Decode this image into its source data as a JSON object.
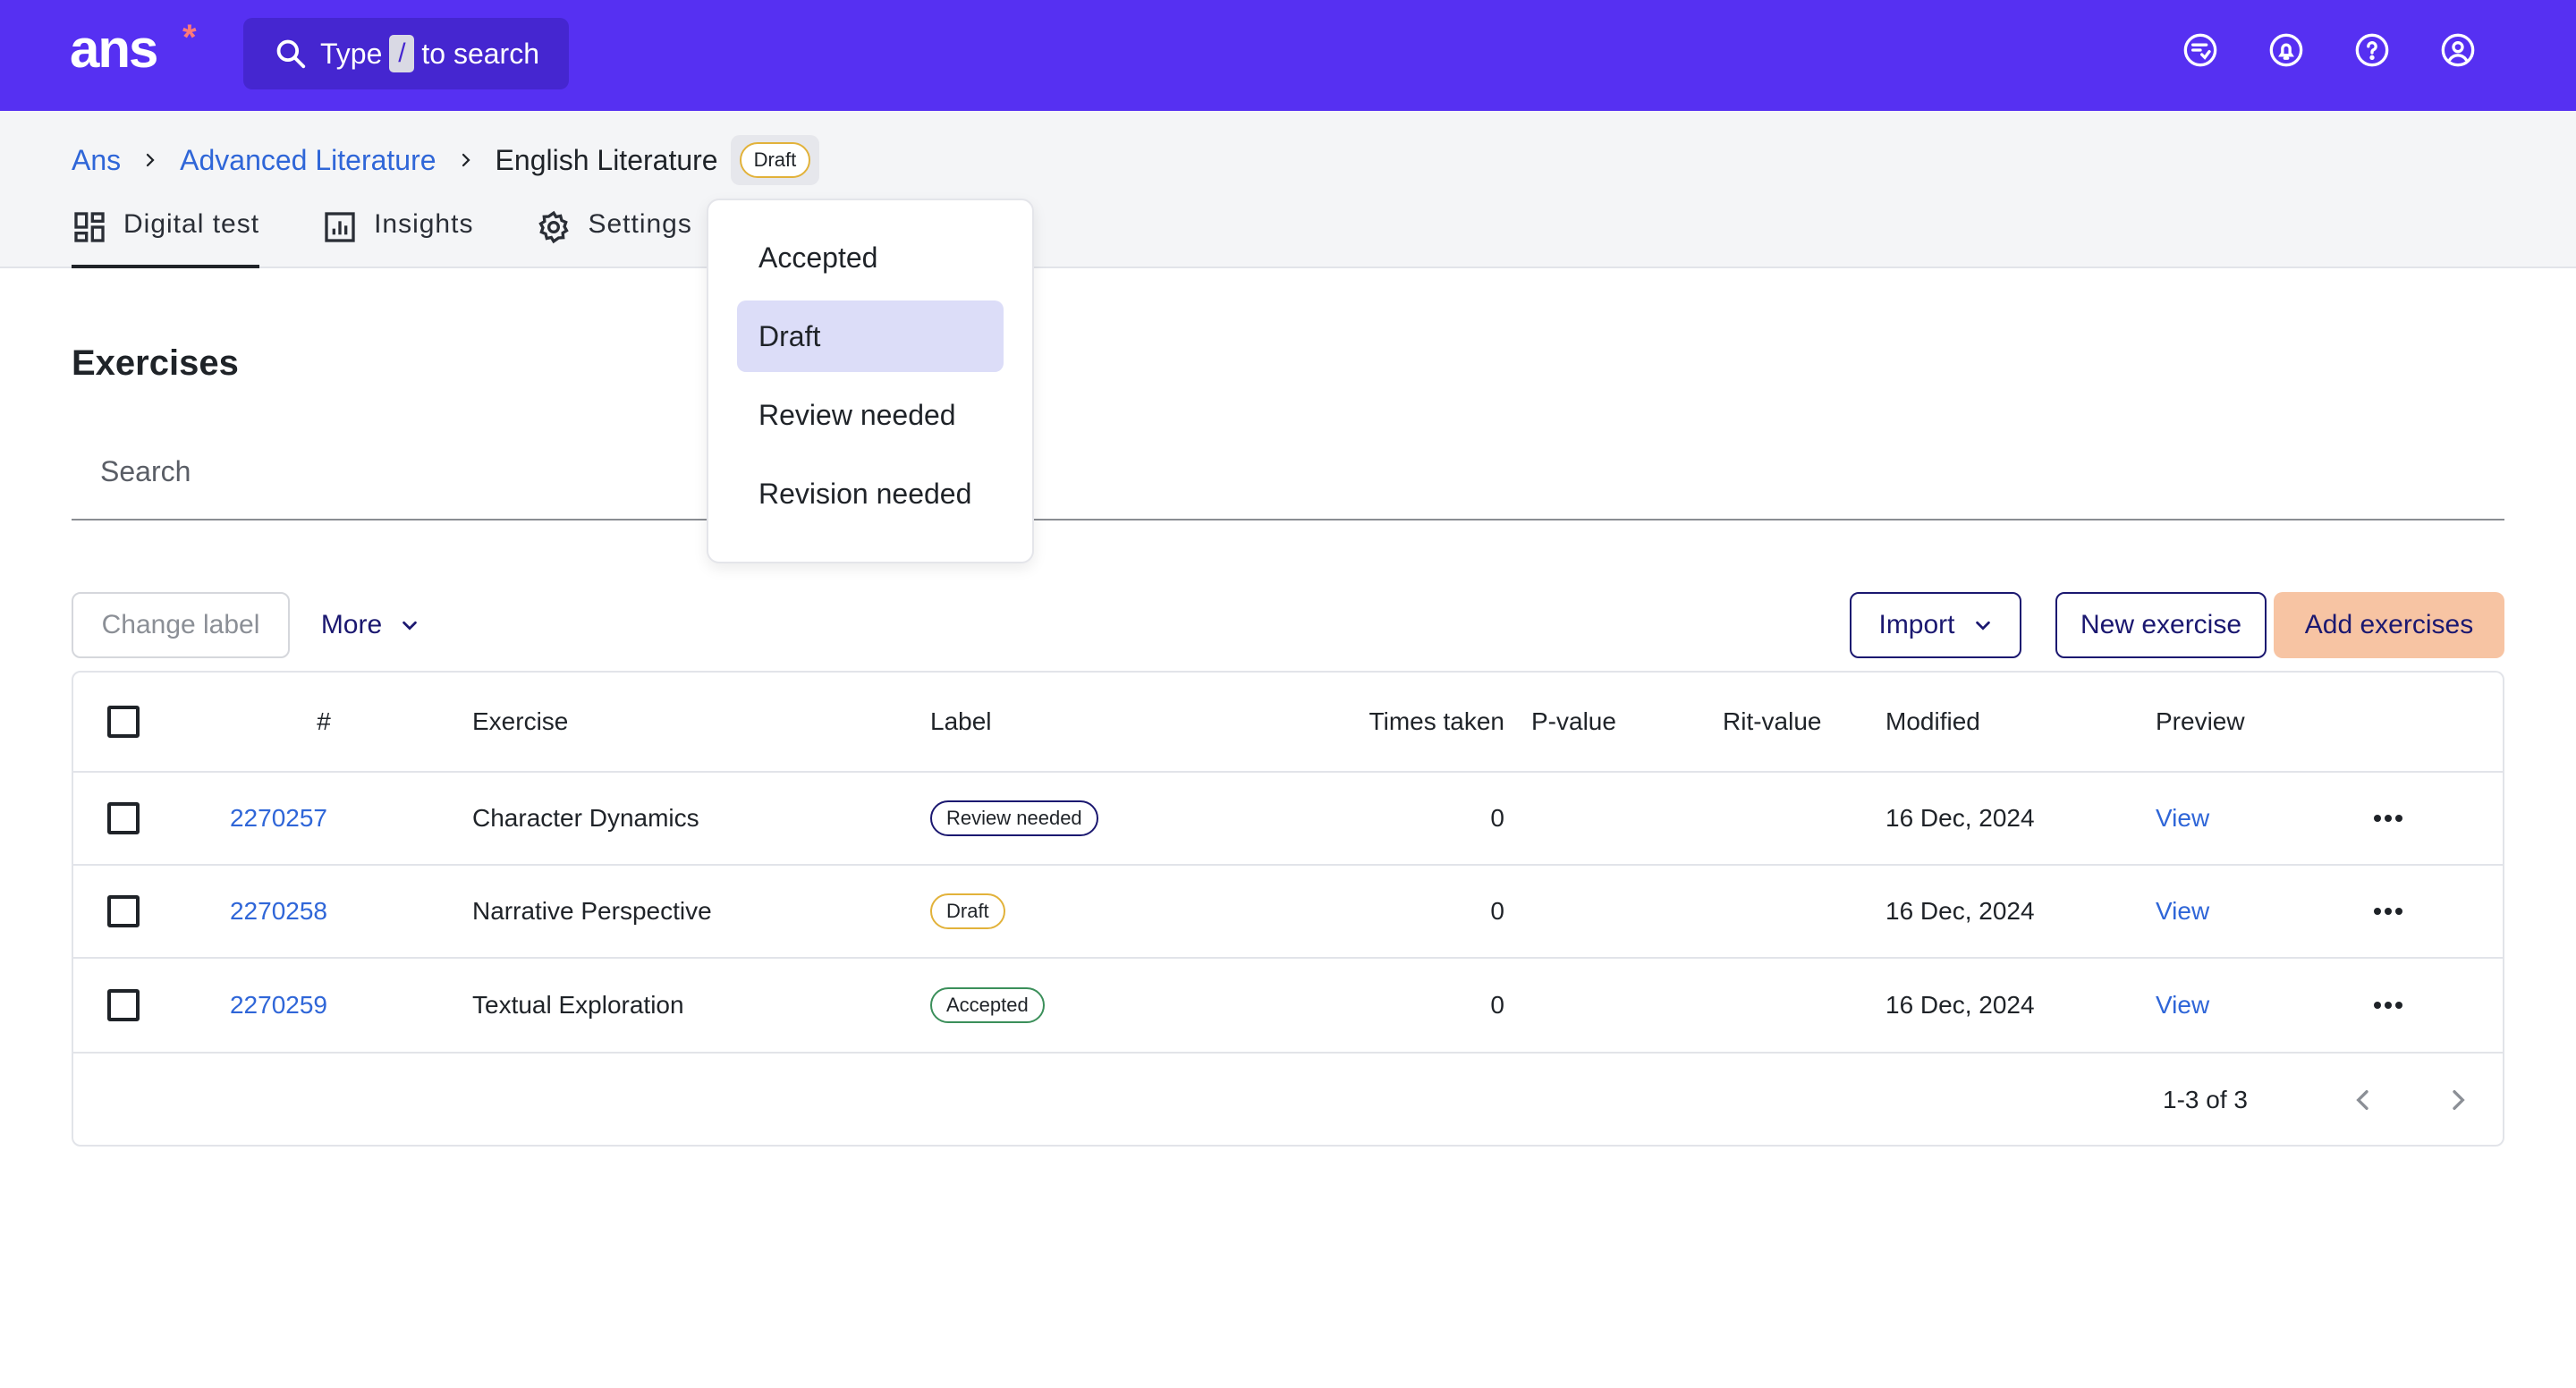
{
  "app": {
    "logo": "ans",
    "logo_mark": "*"
  },
  "search": {
    "prefix": "Type",
    "key": "/",
    "suffix": "to search"
  },
  "top_icons": [
    "checklist-icon",
    "bell-icon",
    "help-icon",
    "account-icon"
  ],
  "breadcrumb": {
    "items": [
      "Ans",
      "Advanced Literature"
    ],
    "current": "English Literature",
    "status": "Draft"
  },
  "tabs": [
    {
      "label": "Digital test",
      "icon": "grid-icon",
      "active": true
    },
    {
      "label": "Insights",
      "icon": "chart-icon"
    },
    {
      "label": "Settings",
      "icon": "gear-icon"
    }
  ],
  "status_menu": {
    "options": [
      "Accepted",
      "Draft",
      "Review needed",
      "Revision needed"
    ],
    "selected": "Draft"
  },
  "exercises": {
    "title": "Exercises",
    "search_placeholder": "Search"
  },
  "toolbar": {
    "change_label": "Change label",
    "more": "More",
    "import": "Import",
    "new_exercise": "New exercise",
    "add_exercises": "Add exercises"
  },
  "table": {
    "columns": [
      "#",
      "Exercise",
      "Label",
      "Times taken",
      "P-value",
      "Rit-value",
      "Modified",
      "Preview"
    ],
    "rows": [
      {
        "id": "2270257",
        "exercise": "Character Dynamics",
        "label": "Review needed",
        "times_taken": "0",
        "p_value": "",
        "rit_value": "",
        "modified": "16 Dec, 2024",
        "preview": "View"
      },
      {
        "id": "2270258",
        "exercise": "Narrative Perspective",
        "label": "Draft",
        "times_taken": "0",
        "p_value": "",
        "rit_value": "",
        "modified": "16 Dec, 2024",
        "preview": "View"
      },
      {
        "id": "2270259",
        "exercise": "Textual Exploration",
        "label": "Accepted",
        "times_taken": "0",
        "p_value": "",
        "rit_value": "",
        "modified": "16 Dec, 2024",
        "preview": "View"
      }
    ],
    "pagination": "1-3 of 3"
  },
  "colors": {
    "topbar": "#5630f2",
    "link": "#2f66d8",
    "primary_text": "#1b1870",
    "add_button": "#f7c4a3",
    "draft": "#e2b23a",
    "accepted": "#3b8f5a"
  }
}
